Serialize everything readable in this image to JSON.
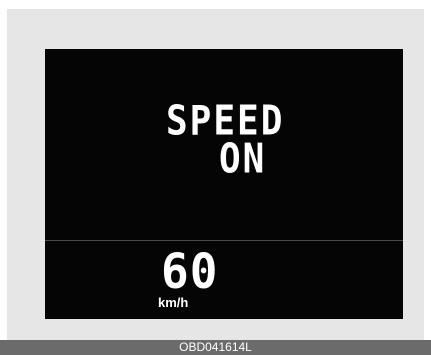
{
  "display": {
    "message_line1": "SPEED",
    "message_line2": "ON",
    "speed_value": "60",
    "speed_unit": "km/h"
  },
  "caption": {
    "text": "OBD041614L"
  },
  "colors": {
    "screen": "#050505",
    "frame": "#e6e6e6",
    "caption_bar": "#6b6b6b",
    "text": "#ffffff"
  }
}
